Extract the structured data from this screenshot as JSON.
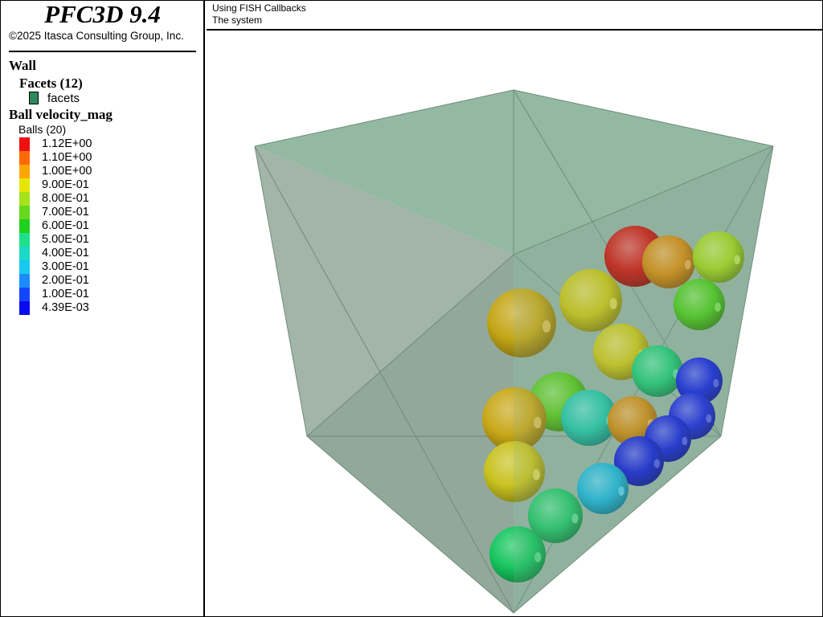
{
  "app": {
    "title": "PFC3D 9.4",
    "copyright": "©2025 Itasca Consulting Group, Inc."
  },
  "header": {
    "line1": "Using FISH Callbacks",
    "line2": "The system"
  },
  "legend": {
    "wall_heading": "Wall",
    "facets_heading": "Facets (12)",
    "facet_item": "facets",
    "facet_color": "#2d8a5b",
    "ball_heading": "Ball velocity_mag",
    "balls_count": "Balls (20)",
    "colorbar": [
      {
        "label": "1.12E+00",
        "color": "#ee1111"
      },
      {
        "label": "1.10E+00",
        "color": "#ff6a00"
      },
      {
        "label": "1.00E+00",
        "color": "#ffa500"
      },
      {
        "label": "9.00E-01",
        "color": "#e6e600"
      },
      {
        "label": "8.00E-01",
        "color": "#a8e21a"
      },
      {
        "label": "7.00E-01",
        "color": "#66d91f"
      },
      {
        "label": "6.00E-01",
        "color": "#1ed11e"
      },
      {
        "label": "5.00E-01",
        "color": "#1ee08a"
      },
      {
        "label": "4.00E-01",
        "color": "#1ed8c8"
      },
      {
        "label": "3.00E-01",
        "color": "#18c8ee"
      },
      {
        "label": "2.00E-01",
        "color": "#1a8cff"
      },
      {
        "label": "1.00E-01",
        "color": "#1446ff"
      },
      {
        "label": "4.39E-03",
        "color": "#0a0aee"
      }
    ]
  },
  "scene": {
    "wall_fill": "#8ab39b",
    "balls": [
      {
        "name": "ball-red",
        "color": "#cc1a10"
      },
      {
        "name": "ball-orange-back",
        "color": "#d28a10"
      },
      {
        "name": "ball-yellowgreen-back",
        "color": "#9ed21c"
      },
      {
        "name": "ball-green-back",
        "color": "#4cc81c"
      },
      {
        "name": "ball-yellow-mid",
        "color": "#c8c214"
      },
      {
        "name": "ball-olive-left",
        "color": "#c4a616"
      },
      {
        "name": "ball-yellow-center",
        "color": "#c8c418"
      },
      {
        "name": "ball-teal",
        "color": "#22c874"
      },
      {
        "name": "ball-blue-1",
        "color": "#1426dc"
      },
      {
        "name": "ball-blue-2",
        "color": "#1828dc"
      },
      {
        "name": "ball-green-mid",
        "color": "#58c61e"
      },
      {
        "name": "ball-cyan-mid",
        "color": "#22c4a6"
      },
      {
        "name": "ball-orange-front",
        "color": "#cc8c14"
      },
      {
        "name": "ball-blue-3",
        "color": "#1424d8"
      },
      {
        "name": "ball-blue-4",
        "color": "#1222d4"
      },
      {
        "name": "ball-olive-front",
        "color": "#c8a818"
      },
      {
        "name": "ball-yellow-front",
        "color": "#c8c21e"
      },
      {
        "name": "ball-cyan-front",
        "color": "#1cb4d4"
      },
      {
        "name": "ball-green-front",
        "color": "#22c468"
      },
      {
        "name": "ball-green-bottom",
        "color": "#16c65e"
      }
    ]
  }
}
